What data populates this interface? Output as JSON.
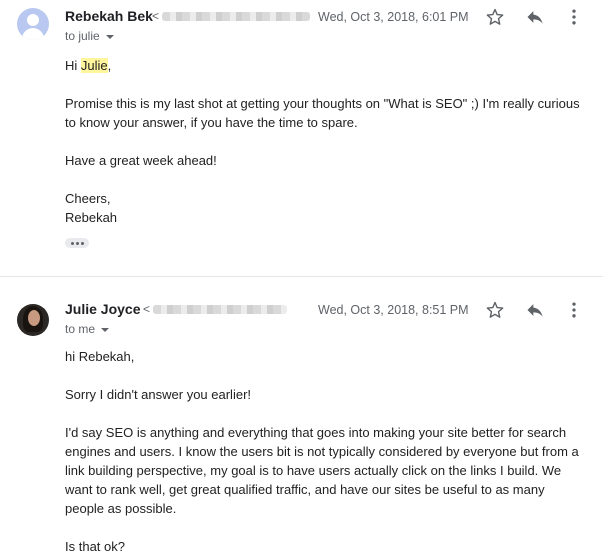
{
  "messages": [
    {
      "sender": "Rebekah Bek",
      "email_prefix": "<",
      "date": "Wed, Oct 3, 2018, 6:01 PM",
      "recipient": "to julie",
      "greeting_prefix": "Hi ",
      "greeting_name": "Julie",
      "greeting_suffix": ",",
      "paragraphs": [
        "Promise this is my last shot at getting your thoughts on \"What is SEO\" ;) I'm really curious to know your answer, if you have the time to spare.",
        "Have a great week ahead!"
      ],
      "signoff": "Cheers,",
      "signature": "Rebekah"
    },
    {
      "sender": "Julie Joyce",
      "email_prefix": "<",
      "date": "Wed, Oct 3, 2018, 8:51 PM",
      "recipient": "to me",
      "greeting": "hi Rebekah,",
      "paragraphs": [
        "Sorry I didn't answer you earlier!",
        "I'd say SEO is anything and everything that goes into making your site better for search engines and users. I know the users bit is not typically considered by everyone but from a link building perspective, my goal is to have users actually click on the links I build. We want to rank well, get great qualified traffic, and have our sites be useful to as many people as possible.",
        "Is that ok?"
      ]
    }
  ],
  "icons": [
    "star-icon",
    "reply-icon",
    "more-vert-icon",
    "chevron-down-icon",
    "expand-dots-icon"
  ],
  "colors": {
    "highlight": "#fff59d",
    "avatar_default": "#b9c8f0",
    "meta_text": "#5f6368"
  }
}
